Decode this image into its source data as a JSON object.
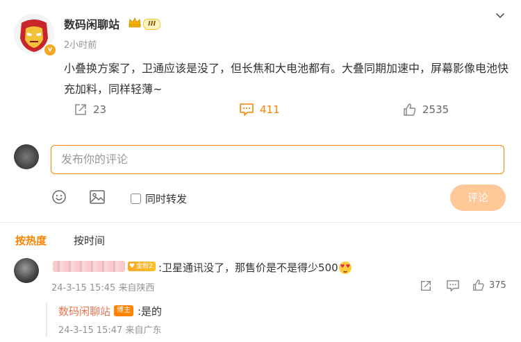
{
  "post": {
    "username": "数码闲聊站",
    "level_badge": "III",
    "time": "2小时前",
    "text": "小叠换方案了，卫通应该是没了，但长焦和大电池都有。大叠同期加速中，屏幕影像电池快充加料，同样轻薄~",
    "verified_badge": "v",
    "shares": "23",
    "comments": "411",
    "likes": "2535"
  },
  "composer": {
    "placeholder": "发布你的评论",
    "repost_label": "同时转发",
    "submit_label": "评论"
  },
  "sort": {
    "hot": "按热度",
    "time": "按时间"
  },
  "comment": {
    "fan_badge": "金粉2",
    "text": ":卫星通讯没了，那售价是不是得少500",
    "meta": "24-3-15 15:45 来自陕西",
    "likes": "375"
  },
  "reply": {
    "username": "数码闲聊站",
    "badge": "博主",
    "text": ":是的",
    "meta": "24-3-15 15:47 来自广东"
  },
  "colors": {
    "accent": "#ff8200",
    "link_orange": "#eb7350",
    "submit_disabled": "#ffc896",
    "muted": "#939393"
  },
  "icons": [
    "chevron-down-icon",
    "share-icon",
    "comment-icon",
    "like-icon",
    "emoji-icon",
    "image-icon",
    "crown-icon"
  ]
}
